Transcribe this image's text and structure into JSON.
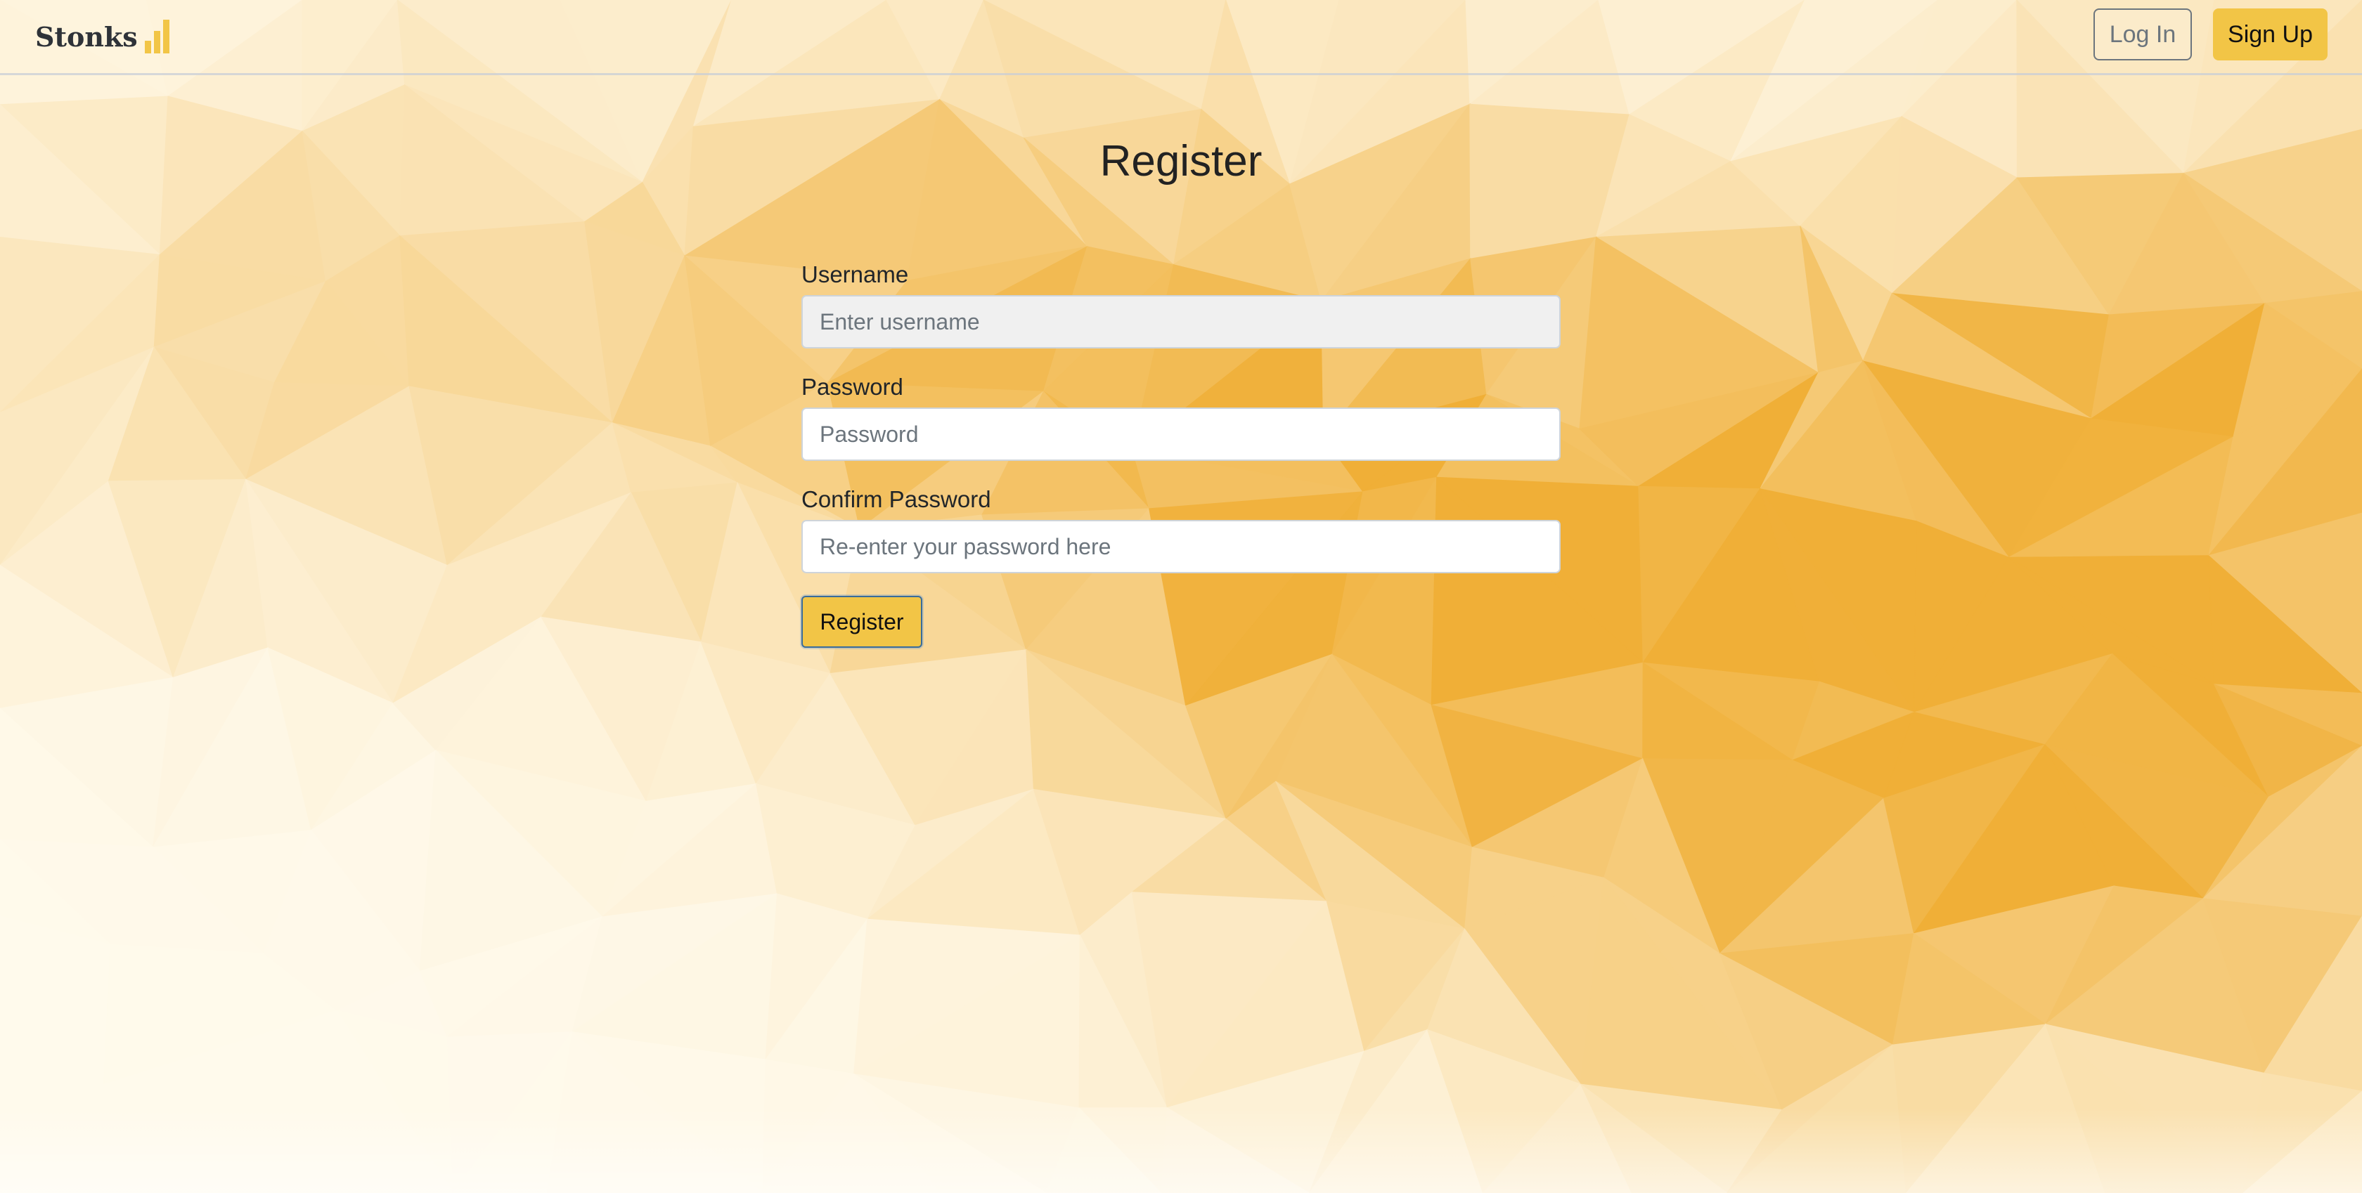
{
  "theme": {
    "accent": "#f2c546",
    "text": "#212529",
    "muted": "#6c757d"
  },
  "navbar": {
    "brand": "Stonks",
    "brand_icon": "bar-chart-icon",
    "login_label": "Log In",
    "signup_label": "Sign Up"
  },
  "register": {
    "title": "Register",
    "username_label": "Username",
    "username_placeholder": "Enter username",
    "password_label": "Password",
    "password_placeholder": "Password",
    "confirm_label": "Confirm Password",
    "confirm_placeholder": "Re-enter your password here",
    "submit_label": "Register"
  }
}
